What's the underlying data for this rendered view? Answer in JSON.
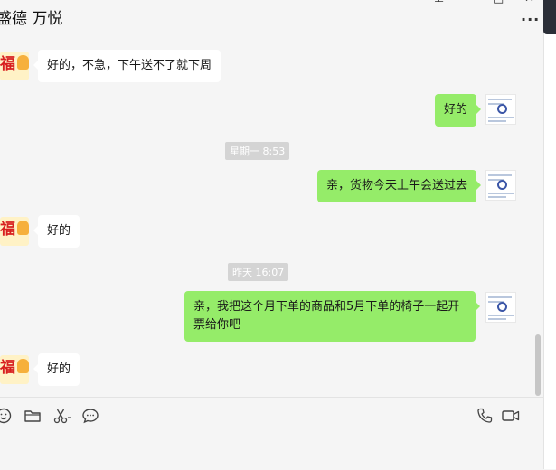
{
  "header": {
    "title": "盛德 万悦",
    "pin_glyph": "⊥",
    "maximize_glyph": "□",
    "close_glyph": "✕",
    "more_glyph": "···"
  },
  "messages": [
    {
      "type": "in",
      "text": "好的，不急，下午送不了就下周"
    },
    {
      "type": "out",
      "text": "好的"
    },
    {
      "type": "time",
      "text": "星期一 8:53"
    },
    {
      "type": "out",
      "text": "亲，货物今天上午会送过去"
    },
    {
      "type": "in",
      "text": "好的"
    },
    {
      "type": "time",
      "text": "昨天 16:07"
    },
    {
      "type": "out",
      "text": "亲，我把这个月下单的商品和5月下单的椅子一起开票给你吧"
    },
    {
      "type": "in",
      "text": "好的"
    }
  ],
  "avatars": {
    "contact_glyph": "福"
  },
  "toolbar": {
    "icons": [
      "emoji-icon",
      "folder-icon",
      "scissors-icon",
      "chat-bubble-icon",
      "phone-icon",
      "video-call-icon"
    ]
  },
  "colors": {
    "incoming_bubble": "#ffffff",
    "outgoing_bubble": "#95ec69",
    "background": "#f5f5f5",
    "timestamp_bg": "#d4d4d4"
  }
}
